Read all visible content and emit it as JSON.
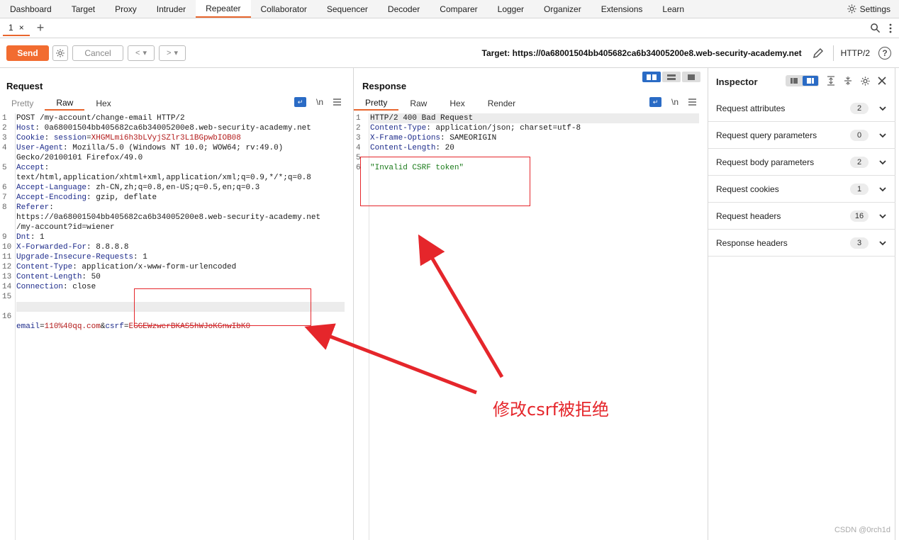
{
  "nav": {
    "tabs": [
      "Dashboard",
      "Target",
      "Proxy",
      "Intruder",
      "Repeater",
      "Collaborator",
      "Sequencer",
      "Decoder",
      "Comparer",
      "Logger",
      "Organizer",
      "Extensions",
      "Learn"
    ],
    "active": "Repeater",
    "settings_label": "Settings"
  },
  "subtabs": {
    "tab_label": "1",
    "close": "×",
    "add": "+"
  },
  "toolbar": {
    "send": "Send",
    "cancel": "Cancel",
    "back": "<",
    "forward": ">",
    "dropdown": "▾",
    "target": "Target: https://0a68001504bb405682ca6b34005200e8.web-security-academy.net",
    "protocol": "HTTP/2",
    "help": "?"
  },
  "request": {
    "title": "Request",
    "tabs": [
      "Pretty",
      "Raw",
      "Hex"
    ],
    "active_tab": "Raw",
    "newline_toggle": "\\n",
    "lines": [
      {
        "n": "1",
        "k": "",
        "v": "POST /my-account/change-email HTTP/2"
      },
      {
        "n": "2",
        "k": "Host",
        "v": "0a68001504bb405682ca6b34005200e8.web-security-academy.net"
      },
      {
        "n": "3",
        "k": "Cookie",
        "v": "session=XHGMLmi6h3bLVyjSZlr3L1BGpwbIOB08"
      },
      {
        "n": "4",
        "k": "User-Agent",
        "v": "Mozilla/5.0 (Windows NT 10.0; WOW64; rv:49.0)"
      },
      {
        "n": "",
        "k": "",
        "v": "Gecko/20100101 Firefox/49.0"
      },
      {
        "n": "5",
        "k": "Accept",
        "v": ""
      },
      {
        "n": "",
        "k": "",
        "v": "text/html,application/xhtml+xml,application/xml;q=0.9,*/*;q=0.8"
      },
      {
        "n": "6",
        "k": "Accept-Language",
        "v": "zh-CN,zh;q=0.8,en-US;q=0.5,en;q=0.3"
      },
      {
        "n": "7",
        "k": "Accept-Encoding",
        "v": "gzip, deflate"
      },
      {
        "n": "8",
        "k": "Referer",
        "v": ""
      },
      {
        "n": "",
        "k": "",
        "v": "https://0a68001504bb405682ca6b34005200e8.web-security-academy.net"
      },
      {
        "n": "",
        "k": "",
        "v": "/my-account?id=wiener"
      },
      {
        "n": "9",
        "k": "Dnt",
        "v": "1"
      },
      {
        "n": "10",
        "k": "X-Forwarded-For",
        "v": "8.8.8.8"
      },
      {
        "n": "11",
        "k": "Upgrade-Insecure-Requests",
        "v": "1"
      },
      {
        "n": "12",
        "k": "Content-Type",
        "v": "application/x-www-form-urlencoded"
      },
      {
        "n": "13",
        "k": "Content-Length",
        "v": "50"
      },
      {
        "n": "14",
        "k": "Connection",
        "v": "close"
      },
      {
        "n": "15",
        "k": "",
        "v": ""
      },
      {
        "n": "16",
        "k": "",
        "v": ""
      }
    ],
    "body": {
      "email_key": "email",
      "email_val": "110%40qq.com",
      "amp": "&",
      "csrf_key": "csrf",
      "csrf_val": "EGGEWzwcrBKAS5hWJoKGnwIbK0"
    }
  },
  "response": {
    "title": "Response",
    "tabs": [
      "Pretty",
      "Raw",
      "Hex",
      "Render"
    ],
    "active_tab": "Pretty",
    "newline_toggle": "\\n",
    "lines": [
      {
        "n": "1",
        "k": "",
        "v": "HTTP/2 400 Bad Request"
      },
      {
        "n": "2",
        "k": "Content-Type",
        "v": "application/json; charset=utf-8"
      },
      {
        "n": "3",
        "k": "X-Frame-Options",
        "v": "SAMEORIGIN"
      },
      {
        "n": "4",
        "k": "Content-Length",
        "v": "20"
      },
      {
        "n": "5",
        "k": "",
        "v": ""
      },
      {
        "n": "6",
        "k": "",
        "v": "\"Invalid CSRF token\""
      }
    ]
  },
  "inspector": {
    "title": "Inspector",
    "rows": [
      {
        "label": "Request attributes",
        "count": "2"
      },
      {
        "label": "Request query parameters",
        "count": "0"
      },
      {
        "label": "Request body parameters",
        "count": "2"
      },
      {
        "label": "Request cookies",
        "count": "1"
      },
      {
        "label": "Request headers",
        "count": "16"
      },
      {
        "label": "Response headers",
        "count": "3"
      }
    ]
  },
  "annotation": {
    "text": "修改csrf被拒绝",
    "color": "#e5262b"
  },
  "watermark": "CSDN @0rch1d",
  "colors": {
    "accent": "#e8662e",
    "send": "#f26c30",
    "blue": "#2a6bc5",
    "header_key": "#1c2a8a",
    "red_value": "#b31b1b",
    "green_value": "#1a7a1a"
  }
}
